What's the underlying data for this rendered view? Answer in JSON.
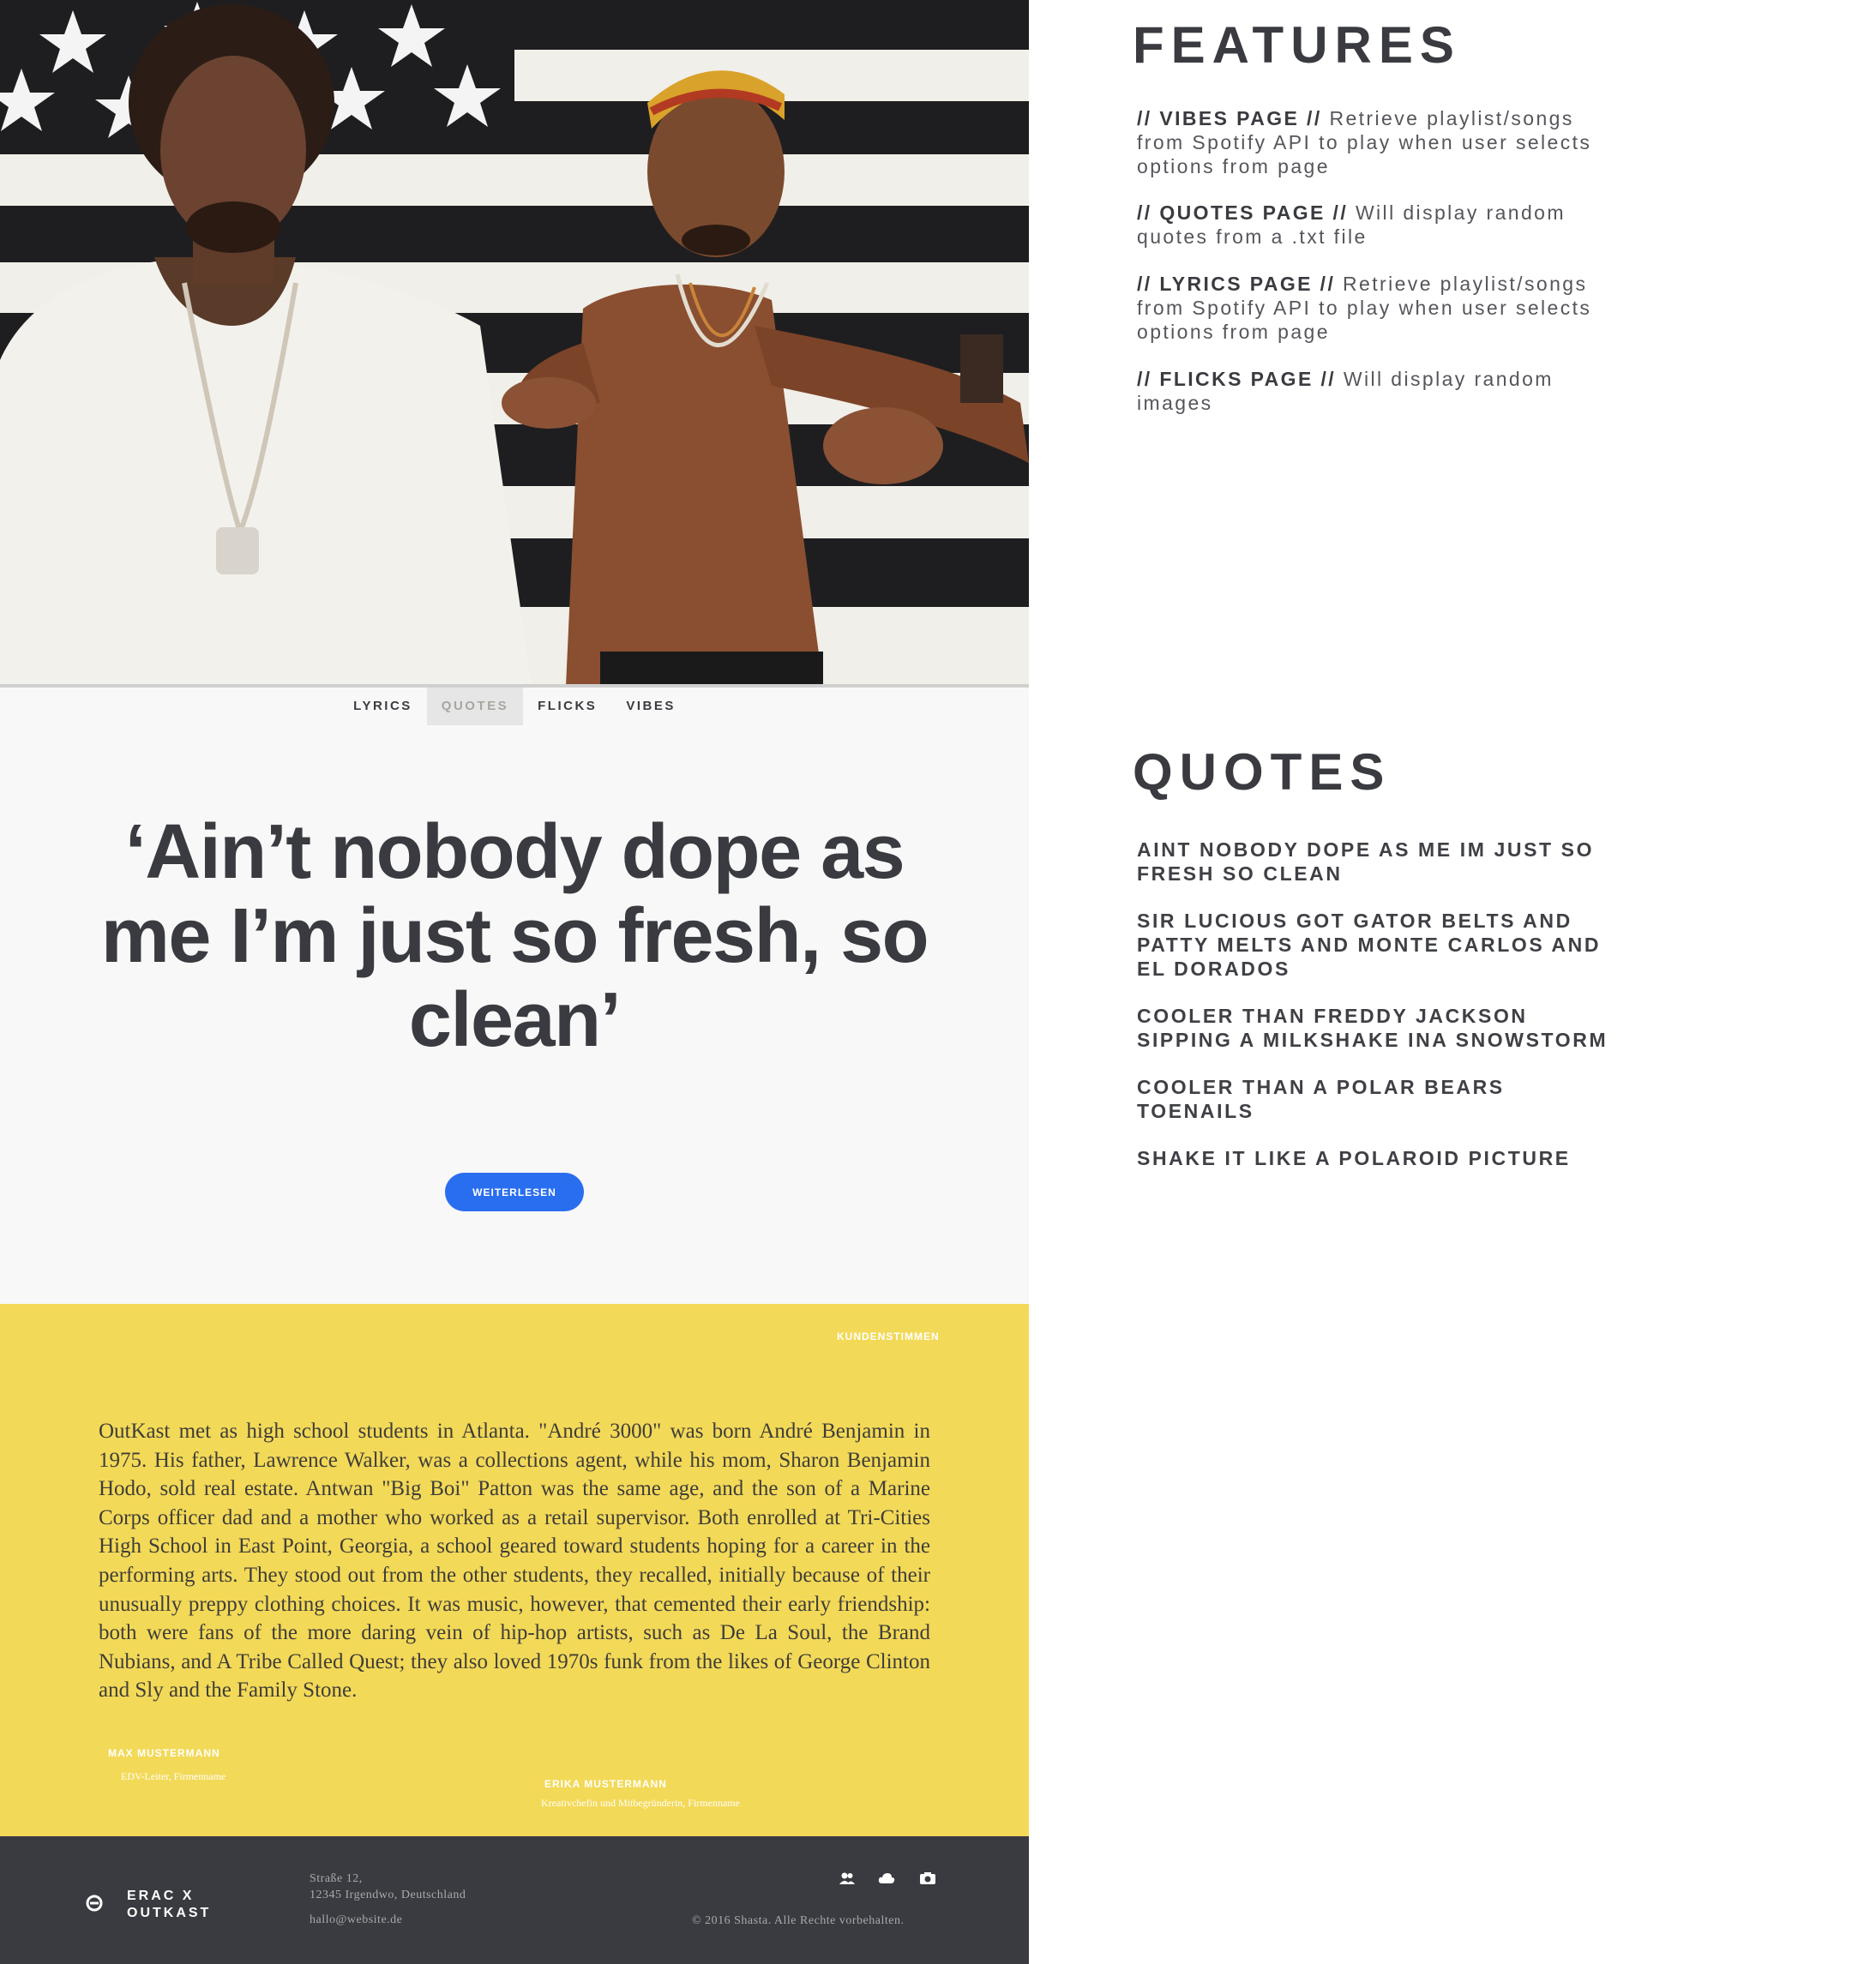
{
  "nav": {
    "items": [
      {
        "label": "LYRICS"
      },
      {
        "label": "QUOTES"
      },
      {
        "label": "FLICKS"
      },
      {
        "label": "VIBES"
      }
    ],
    "active": "QUOTES"
  },
  "hero": {
    "photo_alt": "Outkast duo in front of American flag"
  },
  "quote_section": {
    "quote": "‘Ain’t nobody dope as me I’m just so fresh, so clean’",
    "button_label": "WEITERLESEN",
    "button_color": "#2a6ef0"
  },
  "testimonial": {
    "label": "KUNDENSTIMMEN",
    "bio": "OutKast met as high school students in Atlanta. \"André 3000\" was born André Benjamin in 1975. His father, Lawrence Walker, was a collections agent, while his mom, Sharon Benjamin Hodo, sold real estate. Antwan \"Big Boi\" Patton was the same age, and the son of a Marine Corps officer dad and a mother who worked as a retail supervisor. Both enrolled at Tri-Cities High School in East Point, Georgia, a school geared toward students hoping for a career in the performing arts. They stood out from the other students, they recalled, initially because of their unusually preppy clothing choices. It was music, however, that cemented their early friendship: both were fans of the more daring vein of hip-hop artists, such as De La Soul, the Brand Nubians, and A Tribe Called Quest; they also loved 1970s funk from the likes of George Clinton and Sly and the Family Stone.",
    "people": [
      {
        "name": "MAX MUSTERMANN",
        "role": "EDV-Leiter, Firmenname"
      },
      {
        "name": "ERIKA MUSTERMANN",
        "role": "Kreativchefin und Mitbegründerin, Firmenname"
      }
    ],
    "background_color": "#f3d958"
  },
  "footer": {
    "brand_line1": "ERAC X",
    "brand_line2": "OUTKAST",
    "address_line1": "Straße 12,",
    "address_line2": "12345 Irgendwo, Deutschland",
    "email": "hallo@website.de",
    "copyright": "© 2016 Shasta. Alle Rechte vorbehalten.",
    "icons": [
      "people-icon",
      "cloud-icon",
      "camera-icon"
    ],
    "background_color": "#393b40"
  },
  "features": {
    "heading": "FEATURES",
    "items": [
      {
        "title": "// VIBES PAGE //",
        "text": "Retrieve playlist/songs from Spotify API to play when user selects options from page"
      },
      {
        "title": "// QUOTES PAGE //",
        "text": "Will display random quotes from a .txt file"
      },
      {
        "title": "// LYRICS PAGE //",
        "text": "Retrieve playlist/songs from Spotify API to play when user selects options from page"
      },
      {
        "title": "// FLICKS PAGE //",
        "text": "Will display random images"
      }
    ]
  },
  "quotes": {
    "heading": "QUOTES",
    "items": [
      "AINT NOBODY DOPE AS ME IM JUST SO FRESH SO CLEAN",
      "SIR LUCIOUS GOT GATOR BELTS AND PATTY MELTS AND MONTE CARLOS AND EL DORADOS",
      "COOLER THAN FREDDY JACKSON SIPPING A MILKSHAKE INA SNOWSTORM",
      "COOLER THAN A POLAR BEARS TOENAILS",
      "SHAKE IT LIKE A POLAROID PICTURE"
    ]
  }
}
